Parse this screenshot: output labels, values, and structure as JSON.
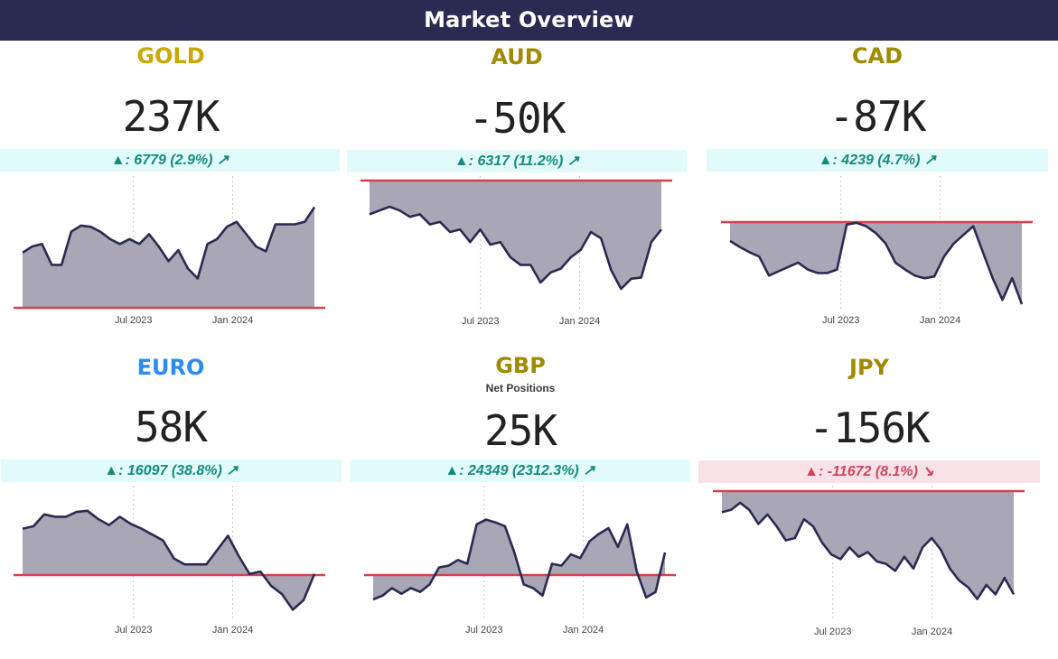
{
  "header": {
    "title": "Market Overview"
  },
  "colors": {
    "header_bg": "#2b2a52",
    "gold_title": "#c9a800",
    "amber_title": "#a08a00",
    "blue_title": "#2b8cf0",
    "up_text": "#178a80",
    "up_bg": "#e0fbfa",
    "down_text": "#d0455e",
    "down_bg": "#f9e2e7",
    "line": "#2b2a52",
    "area": "#a9a6b5",
    "baseline": "#d9404f"
  },
  "panels": [
    {
      "key": "gold",
      "title": "GOLD",
      "title_color": "#c9a800",
      "value": "237K",
      "change": "▲: 6779 (2.9%) ↗",
      "direction": "up"
    },
    {
      "key": "aud",
      "title": "AUD",
      "title_color": "#a08a00",
      "value": "-50K",
      "change": "▲: 6317 (11.2%) ↗",
      "direction": "up"
    },
    {
      "key": "cad",
      "title": "CAD",
      "title_color": "#a08a00",
      "value": "-87K",
      "change": "▲: 4239 (4.7%) ↗",
      "direction": "up"
    },
    {
      "key": "euro",
      "title": "EURO",
      "title_color": "#2b8cf0",
      "value": "58K",
      "change": "▲: 16097 (38.8%) ↗",
      "direction": "up"
    },
    {
      "key": "gbp",
      "title": "GBP",
      "subtitle": "Net Positions",
      "title_color": "#a08a00",
      "value": "25K",
      "change": "▲: 24349 (2312.3%) ↗",
      "direction": "up"
    },
    {
      "key": "jpy",
      "title": "JPY",
      "title_color": "#a08a00",
      "value": "-156K",
      "change": "▲: -11672 (8.1%) ↘",
      "direction": "down"
    }
  ],
  "chart_data": [
    {
      "type": "area",
      "name": "GOLD",
      "x_ticks": [
        "Jul 2023",
        "Jan 2024"
      ],
      "values": [
        0.45,
        0.5,
        0.52,
        0.35,
        0.35,
        0.62,
        0.67,
        0.66,
        0.62,
        0.56,
        0.52,
        0.56,
        0.52,
        0.6,
        0.5,
        0.38,
        0.47,
        0.32,
        0.24,
        0.52,
        0.56,
        0.66,
        0.7,
        0.6,
        0.5,
        0.46,
        0.68,
        0.68,
        0.68,
        0.7,
        0.82
      ]
    },
    {
      "type": "area",
      "name": "AUD",
      "x_ticks": [
        "Jul 2023",
        "Jan 2024"
      ],
      "values": [
        0.74,
        0.77,
        0.8,
        0.77,
        0.72,
        0.74,
        0.66,
        0.68,
        0.6,
        0.62,
        0.52,
        0.62,
        0.5,
        0.52,
        0.4,
        0.34,
        0.34,
        0.2,
        0.28,
        0.31,
        0.4,
        0.46,
        0.6,
        0.55,
        0.3,
        0.15,
        0.23,
        0.24,
        0.52,
        0.62
      ]
    },
    {
      "type": "area",
      "name": "CAD",
      "x_ticks": [
        "Jul 2023",
        "Jan 2024"
      ],
      "values": [
        0.73,
        0.66,
        0.6,
        0.55,
        0.33,
        0.38,
        0.43,
        0.48,
        0.4,
        0.36,
        0.36,
        0.4,
        0.92,
        0.94,
        0.9,
        0.82,
        0.7,
        0.48,
        0.4,
        0.33,
        0.3,
        0.32,
        0.55,
        0.7,
        0.8,
        0.9,
        0.6,
        0.3,
        0.05,
        0.3,
        0.0
      ]
    },
    {
      "type": "area",
      "name": "EURO",
      "x_ticks": [
        "Jul 2023",
        "Jan 2024"
      ],
      "values": [
        0.7,
        0.72,
        0.82,
        0.8,
        0.8,
        0.84,
        0.85,
        0.78,
        0.73,
        0.8,
        0.74,
        0.7,
        0.65,
        0.6,
        0.45,
        0.4,
        0.4,
        0.4,
        0.52,
        0.64,
        0.47,
        0.32,
        0.34,
        0.22,
        0.15,
        0.02,
        0.1,
        0.32
      ]
    },
    {
      "type": "area",
      "name": "GBP",
      "x_ticks": [
        "Jul 2023",
        "Jan 2024"
      ],
      "values": [
        0.0,
        0.04,
        0.12,
        0.06,
        0.12,
        0.08,
        0.16,
        0.34,
        0.36,
        0.42,
        0.38,
        0.8,
        0.85,
        0.82,
        0.78,
        0.5,
        0.16,
        0.12,
        0.04,
        0.38,
        0.36,
        0.48,
        0.44,
        0.62,
        0.7,
        0.76,
        0.56,
        0.8,
        0.3,
        0.02,
        0.08,
        0.5
      ]
    },
    {
      "type": "area",
      "name": "JPY",
      "x_ticks": [
        "Jul 2023",
        "Jan 2024"
      ],
      "values": [
        0.82,
        0.84,
        0.9,
        0.84,
        0.72,
        0.8,
        0.7,
        0.58,
        0.6,
        0.76,
        0.7,
        0.56,
        0.46,
        0.42,
        0.52,
        0.44,
        0.48,
        0.4,
        0.38,
        0.32,
        0.44,
        0.34,
        0.52,
        0.6,
        0.5,
        0.34,
        0.24,
        0.18,
        0.08,
        0.2,
        0.12,
        0.26,
        0.12
      ]
    }
  ]
}
